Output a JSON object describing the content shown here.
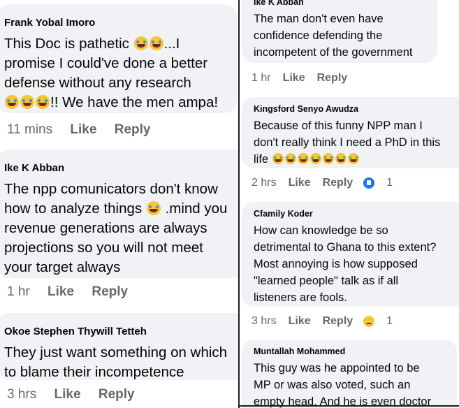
{
  "left_comments": [
    {
      "author": "Frank Yobal Imoro",
      "text_lines": [
        "This Doc is pathetic",
        "promise I could've done a better",
        "defense without any research",
        "!! We have the men ampa!"
      ],
      "text_l1_suffix": "...I",
      "time": "11 mins",
      "like": "Like",
      "reply": "Reply"
    },
    {
      "author": "Ike K Abban",
      "text_lines": [
        "The npp comunicators don't know",
        "how to analyze things",
        "revenue generations are always",
        "projections so you will not meet",
        "your target always"
      ],
      "text_l2_suffix": ".mind you",
      "time": "1 hr",
      "like": "Like",
      "reply": "Reply"
    },
    {
      "author": "Okoe Stephen Thywill Tetteh",
      "text_lines": [
        "They just want something on which",
        "to blame their incompetence"
      ],
      "time": "3 hrs",
      "like": "Like",
      "reply": "Reply"
    }
  ],
  "right_comments": [
    {
      "author": "Ike K Abban",
      "text_lines": [
        "The man don't even have",
        "confidence defending the",
        "incompetent of the government"
      ],
      "time": "1 hr",
      "like": "Like",
      "reply": "Reply"
    },
    {
      "author": "Kingsford Senyo Awudza",
      "text_lines": [
        "Because of this funny NPP man I",
        "don't really think I need a PhD in this",
        "life"
      ],
      "time": "2 hrs",
      "like": "Like",
      "reply": "Reply",
      "reaction_count": "1",
      "reaction_icon": "like-reaction-icon"
    },
    {
      "author": "Cfamily Koder",
      "text_lines": [
        "How can knowledge be so",
        "detrimental to Ghana to this extent?",
        "Most annoying is how supposed",
        "\"learned people\" talk as if all",
        "listeners are fools."
      ],
      "time": "3 hrs",
      "like": "Like",
      "reply": "Reply",
      "reaction_count": "1",
      "reaction_icon": "sad-reaction-icon"
    },
    {
      "author": "Muntallah Mohammed",
      "text_lines": [
        "This guy was he appointed to be",
        "MP  or was also voted, such an",
        "empty head. And he is even doctor"
      ]
    }
  ],
  "colors": {
    "bubble_bg": "#f0f2f5",
    "meta_text": "#65676b",
    "like_blue": "#1877f2",
    "emoji_yellow": "#f7c531"
  }
}
